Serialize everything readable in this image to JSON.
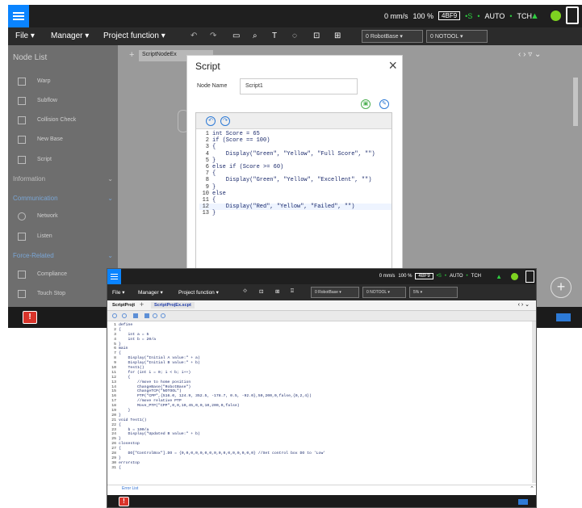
{
  "back": {
    "status": {
      "speed": "0 mm/s",
      "percent": "100 %",
      "code": "4BF9",
      "safety": "S",
      "auto": "AUTO",
      "tch": "TCH"
    },
    "toolbar": {
      "file": "File",
      "manager": "Manager",
      "project_function": "Project function",
      "base": "0 RobotBase",
      "tool": "0 NOTOOL"
    },
    "tab_label": "ScriptNodeEx",
    "node_list": {
      "title": "Node List",
      "items": [
        "Warp",
        "Subflow",
        "Collision Check",
        "New Base",
        "Script"
      ],
      "sections": [
        "Information",
        "Communication",
        "Force-Related"
      ],
      "communication_items": [
        "Network",
        "Listen"
      ],
      "force_items": [
        "Compliance",
        "Touch Stop"
      ]
    }
  },
  "dialog": {
    "title": "Script",
    "node_name_label": "Node Name",
    "node_name_value": "Script1",
    "code": [
      "int Score = 65",
      "if (Score == 100)",
      "{",
      "    Display(\"Green\", \"Yellow\", \"Full Score\", \"\")",
      "}",
      "else if (Score >= 60)",
      "{",
      "    Display(\"Green\", \"Yellow\", \"Excellent\", \"\")",
      "}",
      "else",
      "{",
      "    Display(\"Red\", \"Yellow\", \"Failed\", \"\")",
      "}"
    ]
  },
  "front": {
    "status": {
      "speed": "0 mm/s",
      "percent": "100 %",
      "code": "4BF9",
      "safety": "S",
      "auto": "AUTO",
      "tch": "TCH"
    },
    "toolbar": {
      "file": "File",
      "manager": "Manager",
      "project_function": "Project function",
      "base": "0 RobotBase",
      "tool": "0 NOTOOL",
      "speed_pct": "5%"
    },
    "tabs": [
      "ScriptProjt",
      "ScriptProjEx.scpt"
    ],
    "error_list": "Error List",
    "code": [
      "define",
      "{",
      "    int a = 5",
      "    int b = 20/a",
      "}",
      "main",
      "{",
      "    Display(\"Initial A value:\" + a)",
      "    Display(\"Initial B value:\" + b)",
      "    Test1()",
      "    for (int i = 0; i < b; i++)",
      "    {",
      "        //move to home position",
      "        ChangeBase(\"RobotBase\")",
      "        ChangeTCP(\"NOTOOL\")",
      "        PTP(\"CPP\",{516.0, 124.9, 352.5, -178.7, 0.5, -92.0},50,200,0,false,{0,2,4})",
      "        //move relative PTP",
      "        Move_PTP(\"CPP\",0,0,10,45,0,0,10,200,0,false)",
      "    }",
      "}",
      "void Test1()",
      "{",
      "    b = 100/a",
      "    Display(\"Updated B value:\" + b)",
      "}",
      "closestop",
      "{",
      "    DO[\"ControlBox\"].DO = {0,0,0,0,0,0,0,0,0,0,0,0,0,0,0,0} //Set control box DO to 'Low'",
      "}",
      "errorstop",
      "{"
    ]
  },
  "colors": {
    "accent_blue": "#0a84ff",
    "status_green": "#2ecc40",
    "error_red": "#d9342b"
  }
}
